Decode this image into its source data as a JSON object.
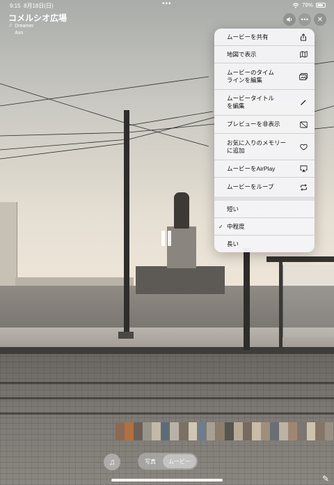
{
  "status_bar": {
    "time": "9:15",
    "date": "8月18日(日)",
    "dots": "•••",
    "battery": "79%"
  },
  "header": {
    "title": "コメルシオ広場",
    "song": "Dreamer",
    "artist": "Axn"
  },
  "menu": {
    "items": [
      {
        "label": "ムービーを共有",
        "icon": "share-icon"
      },
      {
        "label": "地図で表示",
        "icon": "map-icon"
      },
      {
        "label": "ムービーのタイム\nラインを編集",
        "icon": "timeline-edit-icon"
      },
      {
        "label": "ムービータイトル\nを編集",
        "icon": "pencil-icon"
      },
      {
        "label": "プレビューを非表示",
        "icon": "hide-preview-icon"
      },
      {
        "label": "お気に入りのメモリー\nに追加",
        "icon": "heart-icon"
      },
      {
        "label": "ムービーをAirPlay",
        "icon": "airplay-icon"
      },
      {
        "label": "ムービーをループ",
        "icon": "loop-icon"
      }
    ],
    "durations": [
      {
        "label": "短い",
        "checked": false
      },
      {
        "label": "中程度",
        "checked": true
      },
      {
        "label": "長い",
        "checked": false
      }
    ]
  },
  "bottom": {
    "seg_photos": "写真",
    "seg_movie": "ムービー"
  },
  "thumb_colors": [
    "#8a6a55",
    "#b07040",
    "#6b6058",
    "#9a9488",
    "#c4b8a8",
    "#5e6b78",
    "#b9b2a4",
    "#7c7064",
    "#d2c6b2",
    "#6e7d8c",
    "#a9a092",
    "#8c7e6c",
    "#585450",
    "#b8aa98",
    "#776b5d",
    "#c9bba6",
    "#9e8f7c",
    "#6a6f74",
    "#bdb3a3",
    "#a08670",
    "#7d7570",
    "#cfc2ad",
    "#857565",
    "#9a8f80"
  ]
}
